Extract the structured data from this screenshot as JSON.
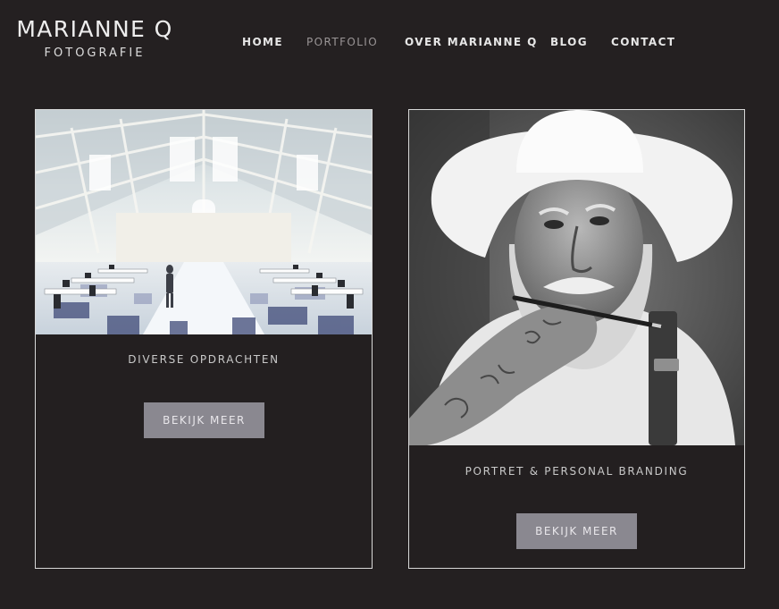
{
  "logo": {
    "name": "MARIANNE Q",
    "subtitle": "FOTOGRAFIE"
  },
  "nav": {
    "items": [
      {
        "label": "HOME",
        "active": false
      },
      {
        "label": "PORTFOLIO",
        "active": true
      },
      {
        "label": "OVER MARIANNE Q",
        "active": false
      },
      {
        "label": "BLOG",
        "active": false
      },
      {
        "label": "CONTACT",
        "active": false
      }
    ]
  },
  "cards": [
    {
      "title": "DIVERSE OPDRACHTEN",
      "button_label": "BEKIJK MEER"
    },
    {
      "title": "PORTRET & PERSONAL BRANDING",
      "button_label": "BEKIJK MEER"
    }
  ],
  "colors": {
    "background": "#242021",
    "nav_active": "#9a9596",
    "button": "#8a8890",
    "card_border": "#d8d8d8"
  }
}
